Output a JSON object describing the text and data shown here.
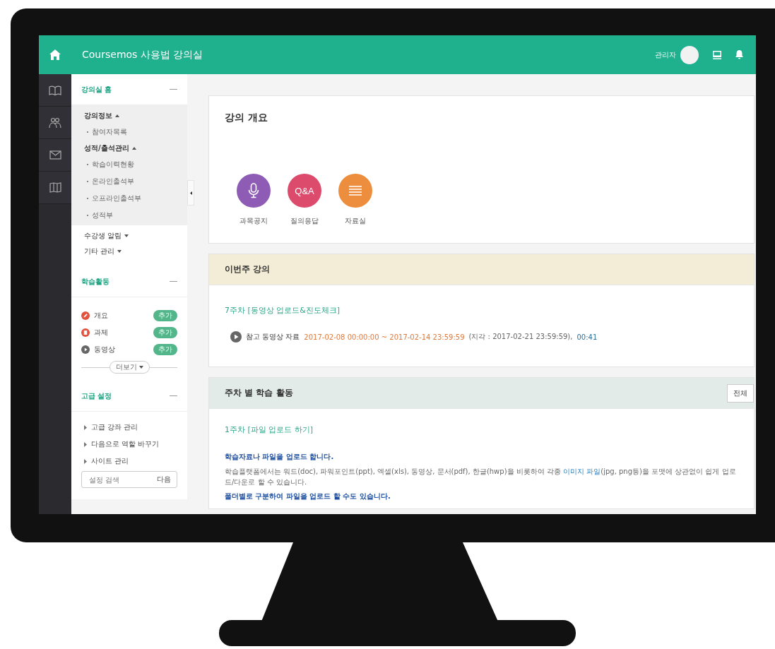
{
  "header": {
    "title": "Coursemos 사용법 강의실",
    "user": "관리자"
  },
  "sidebar": {
    "home": {
      "title": "강의실 홈"
    },
    "menu": [
      {
        "label": "강의정보",
        "expanded": true,
        "children": [
          {
            "label": "참여자목록"
          }
        ]
      },
      {
        "label": "성적/출석관리",
        "expanded": true,
        "children": [
          {
            "label": "학습이력현황"
          },
          {
            "label": "온라인출석부"
          },
          {
            "label": "오프라인출석부"
          },
          {
            "label": "성적부"
          }
        ]
      },
      {
        "label": "수강생 알림",
        "expanded": false
      },
      {
        "label": "기타 관리",
        "expanded": false
      }
    ],
    "activities": {
      "title": "학습활동",
      "items": [
        {
          "label": "개요",
          "kind": "overview",
          "action": "추가"
        },
        {
          "label": "과제",
          "kind": "assignment",
          "action": "추가"
        },
        {
          "label": "동영상",
          "kind": "video",
          "action": "추가"
        }
      ],
      "more": "더보기"
    },
    "advanced": {
      "title": "고급 설정",
      "links": [
        "고급 강좌 관리",
        "다음으로 역할 바꾸기",
        "사이트 관리"
      ],
      "search": {
        "placeholder": "설정 검색",
        "button": "다음"
      }
    }
  },
  "overview": {
    "title": "강의 개요",
    "shortcuts": [
      {
        "label": "과목공지",
        "kind": "notice",
        "color": "#8e5bb5"
      },
      {
        "label": "질의응답",
        "kind": "qna",
        "color": "#dc4a6c",
        "text": "Q&A"
      },
      {
        "label": "자료실",
        "kind": "archive",
        "color": "#ec8e3d"
      }
    ]
  },
  "this_week": {
    "title": "이번주 강의",
    "week": "7주차 [동영상 업로드&진도체크]",
    "item": {
      "name": "참고 동영상 자료",
      "period": "2017-02-08 00:00:00 ~ 2017-02-14 23:59:59",
      "late": "(지각 : 2017-02-21 23:59:59),",
      "duration": "00:41"
    }
  },
  "weekly": {
    "title": "주차 별 학습 활동",
    "button": "전체",
    "week": "1주차 [파일 업로드 하기]",
    "paragraphs": [
      {
        "kind": "emphasis",
        "text": "학습자료나 파일을 업로드 합니다."
      },
      {
        "kind": "body",
        "before": "학습플랫폼에서는 워드(doc), 파워포인트(ppt), 엑셀(xls), 동영상, 문서(pdf), 한글(hwp)을 비롯하여 각종 ",
        "link": "이미지 파일",
        "after": "(jpg, png등)을 포맷에 상관없이 쉽게 업로드/다운로 할 수 있습니다."
      },
      {
        "kind": "emphasis",
        "text": "폴더별로 구분하여 파일을 업로드 할 수도 있습니다."
      }
    ]
  }
}
